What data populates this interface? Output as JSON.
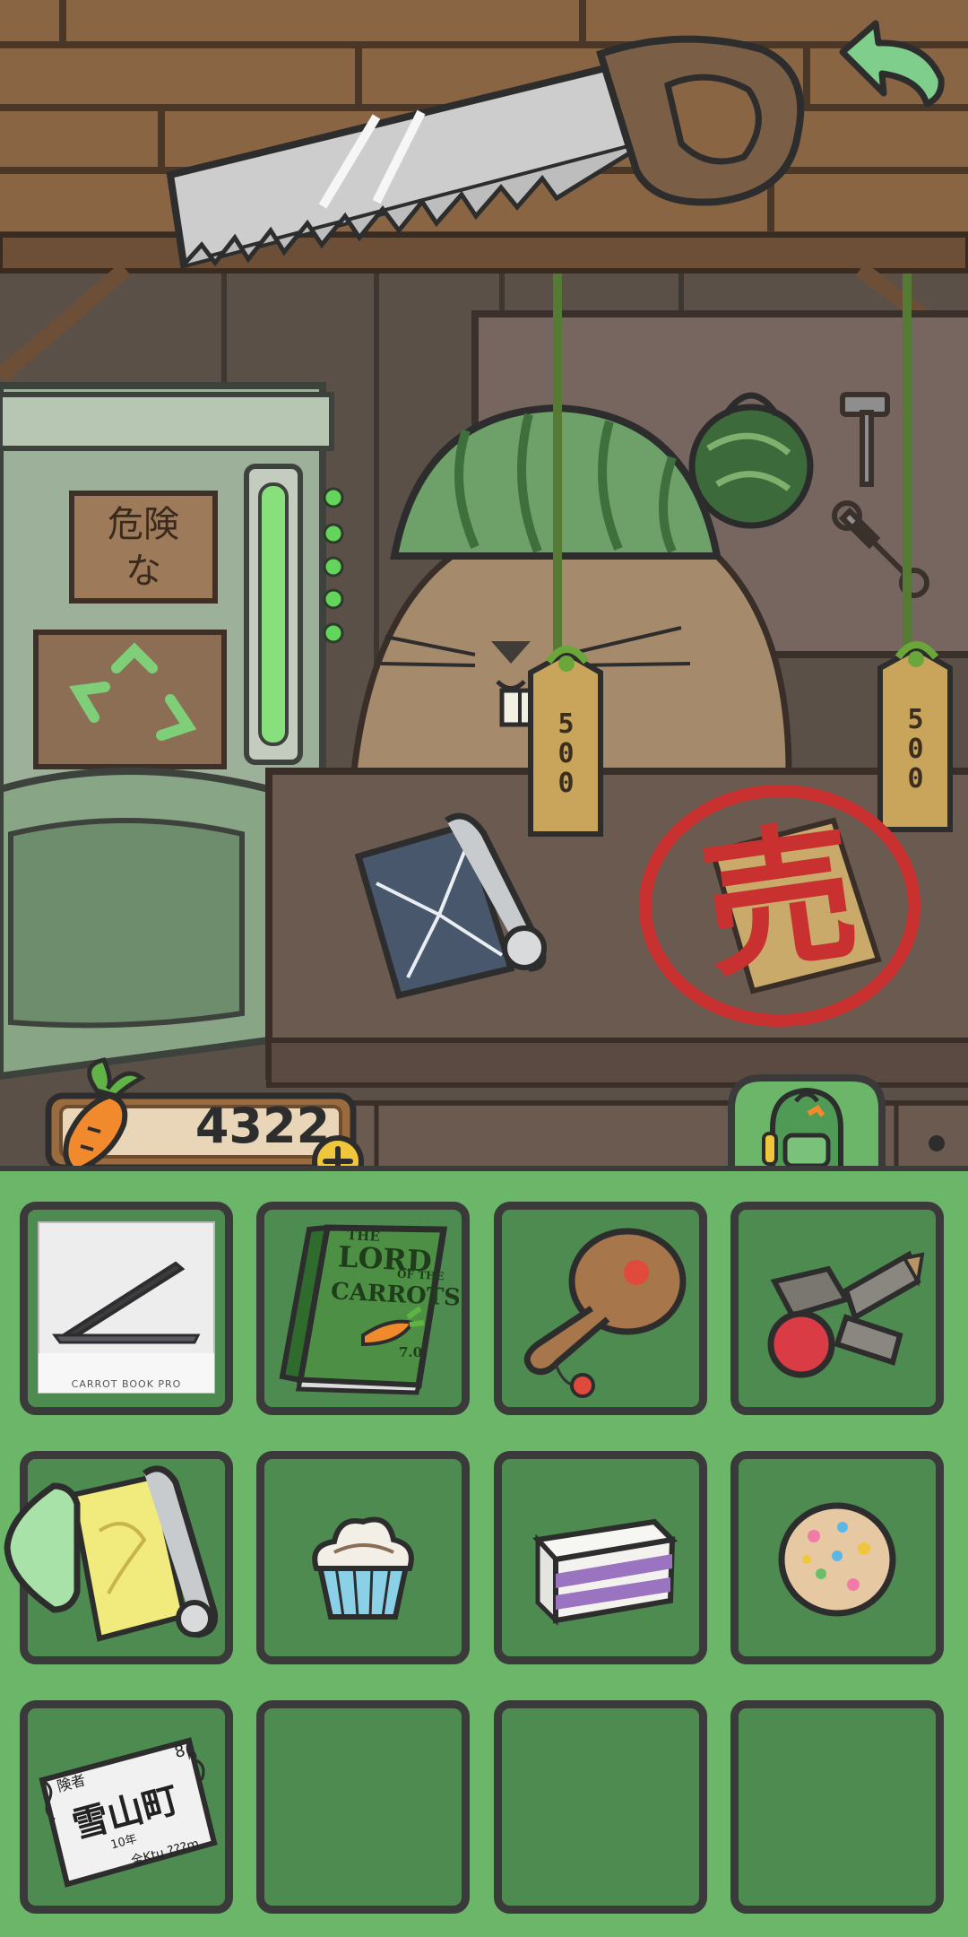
{
  "shop": {
    "price_tags": [
      "500",
      "500"
    ],
    "sold_stamp": "売",
    "danger_sign": [
      "危険",
      "な"
    ]
  },
  "currency": {
    "icon": "carrot-icon",
    "amount": "4322",
    "add_icon": "plus-icon"
  },
  "navigation": {
    "back_icon": "back-arrow-icon",
    "inventory_tab_icon": "backpack-icon"
  },
  "inventory": {
    "laptop_caption": "CARROT BOOK PRO",
    "book_title_lines": [
      "THE",
      "LORD",
      "OF THE",
      "CARROTS"
    ],
    "book_suffix": "7.0",
    "ticket_text": {
      "top_left": "険者",
      "top_right": "8",
      "top_right_small": "m",
      "main": "雪山町",
      "line_small": "10年",
      "bottom": "全Ktu ???m"
    },
    "items": [
      {
        "name": "laptop"
      },
      {
        "name": "book"
      },
      {
        "name": "paddle-toy"
      },
      {
        "name": "kendama"
      },
      {
        "name": "map-scroll"
      },
      {
        "name": "cupcake"
      },
      {
        "name": "cake-slice"
      },
      {
        "name": "cookie"
      },
      {
        "name": "ticket"
      },
      {
        "name": "empty"
      },
      {
        "name": "empty"
      },
      {
        "name": "empty"
      }
    ]
  }
}
